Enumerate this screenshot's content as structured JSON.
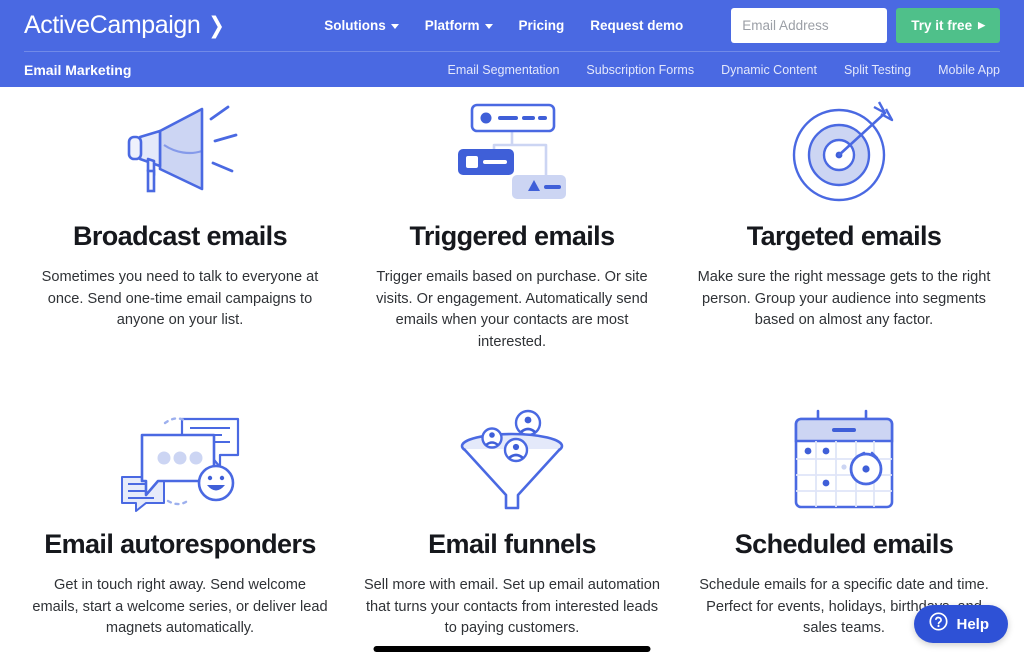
{
  "header": {
    "brand": "ActiveCampaign",
    "brand_chevron": "chevron-right-icon",
    "nav": [
      {
        "label": "Solutions",
        "has_caret": true
      },
      {
        "label": "Platform",
        "has_caret": true
      },
      {
        "label": "Pricing",
        "has_caret": false
      },
      {
        "label": "Request demo",
        "has_caret": false
      }
    ],
    "email_placeholder": "Email Address",
    "email_value": "",
    "cta_label": "Try it free",
    "cta_arrow": "▶",
    "brand_color": "#4a69e2",
    "cta_color": "#4fc08a"
  },
  "subheader": {
    "title": "Email Marketing",
    "links": [
      "Email Segmentation",
      "Subscription Forms",
      "Dynamic Content",
      "Split Testing",
      "Mobile App"
    ]
  },
  "features": [
    {
      "icon": "megaphone-icon",
      "title": "Broadcast emails",
      "desc": "Sometimes you need to talk to everyone at once. Send one-time email campaigns to anyone on your list."
    },
    {
      "icon": "automation-flow-icon",
      "title": "Triggered emails",
      "desc": "Trigger emails based on purchase. Or site visits. Or engagement. Automatically send emails when your contacts are most interested."
    },
    {
      "icon": "target-bullseye-icon",
      "title": "Targeted emails",
      "desc": "Make sure the right message gets to the right person. Group your audience into segments based on almost any factor."
    },
    {
      "icon": "chat-bubbles-icon",
      "title": "Email autoresponders",
      "desc": "Get in touch right away. Send welcome emails, start a welcome series, or deliver lead magnets automatically."
    },
    {
      "icon": "funnel-icon",
      "title": "Email funnels",
      "desc": "Sell more with email. Set up email automation that turns your contacts from interested leads to paying customers."
    },
    {
      "icon": "calendar-clock-icon",
      "title": "Scheduled emails",
      "desc": "Schedule emails for a specific date and time. Perfect for events, holidays, birthdays, and sales teams."
    }
  ],
  "help_widget": {
    "label": "Help",
    "icon": "question-mark-circle-icon",
    "color": "#2e51d6"
  },
  "icon_palette": {
    "stroke": "#4a69e2",
    "fill_light": "#cdd6f4",
    "fill_solid": "#3f5fd8"
  }
}
